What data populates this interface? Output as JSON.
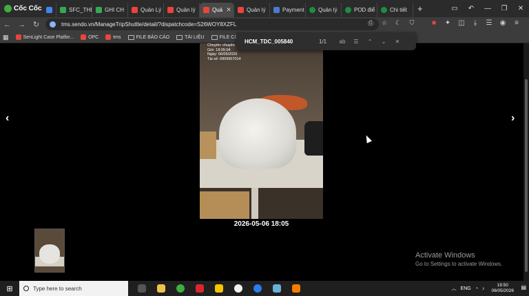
{
  "browser": {
    "brand": "Cốc Cốc",
    "tabs": [
      {
        "label": "",
        "color": "#4285f4",
        "active": false
      },
      {
        "label": "SFC_THE",
        "color": "#34a853",
        "active": false
      },
      {
        "label": "GHI CH",
        "color": "#34a853",
        "active": false
      },
      {
        "label": "Quản Lý",
        "color": "#e8453c",
        "active": false
      },
      {
        "label": "Quản lý",
        "color": "#e8453c",
        "active": false
      },
      {
        "label": "Quả",
        "color": "#e8453c",
        "active": true
      },
      {
        "label": "Quản lý",
        "color": "#e8453c",
        "active": false
      },
      {
        "label": "Payment",
        "color": "#4a7bd0",
        "active": false
      },
      {
        "label": "Quản lý",
        "color": "#1e8e3e",
        "active": false
      },
      {
        "label": "POD điể",
        "color": "#1e8e3e",
        "active": false
      },
      {
        "label": "Chi tiết",
        "color": "#1e8e3e",
        "active": false
      }
    ],
    "new_tab": "+",
    "url": "tms.sendo.vn/ManageTripShuttle/detail/?dispatchcode=S26WOY8XZFL",
    "bookmarks": [
      {
        "label": "SenLight Case Platfor...",
        "type": "site",
        "color": "#e8453c"
      },
      {
        "label": "OPC",
        "type": "site",
        "color": "#e8453c"
      },
      {
        "label": "tms",
        "type": "site",
        "color": "#e8453c"
      },
      {
        "label": "FILE BÁO CÁO",
        "type": "folder"
      },
      {
        "label": "TÀI LIỆU",
        "type": "folder"
      },
      {
        "label": "FILE CÔNG VIỆC",
        "type": "folder"
      }
    ]
  },
  "findbar": {
    "query": "HCM_TDC_005840",
    "count": "1/1"
  },
  "viewer": {
    "prev_arrow": "‹",
    "next_arrow": "›",
    "photo_stamp": [
      "Chuyến: chuyến",
      "Giờ: 18:05:04",
      "Ngày: 06/05/2026",
      "Tài xế: 0909957014"
    ],
    "caption": "2026-05-06 18:05"
  },
  "watermark": {
    "title": "Activate Windows",
    "subtitle": "Go to Settings to activate Windows."
  },
  "taskbar": {
    "search_placeholder": "Type here to search",
    "apps": [
      {
        "name": "task-view",
        "color": "#3a3a3a"
      },
      {
        "name": "file-explorer",
        "color": "#f0c24b"
      },
      {
        "name": "coccoc",
        "color": "#3fae3f"
      },
      {
        "name": "wps",
        "color": "#d9272e"
      },
      {
        "name": "sticky",
        "color": "#f5c400"
      },
      {
        "name": "chrome",
        "color": "#f2f2f2"
      },
      {
        "name": "zalo",
        "color": "#2b7de9"
      },
      {
        "name": "notepad",
        "color": "#68b0d8"
      },
      {
        "name": "app-orange",
        "color": "#f57c00"
      }
    ],
    "clock_time": "19:50",
    "clock_date": "06/05/2026",
    "notifications": "17"
  }
}
